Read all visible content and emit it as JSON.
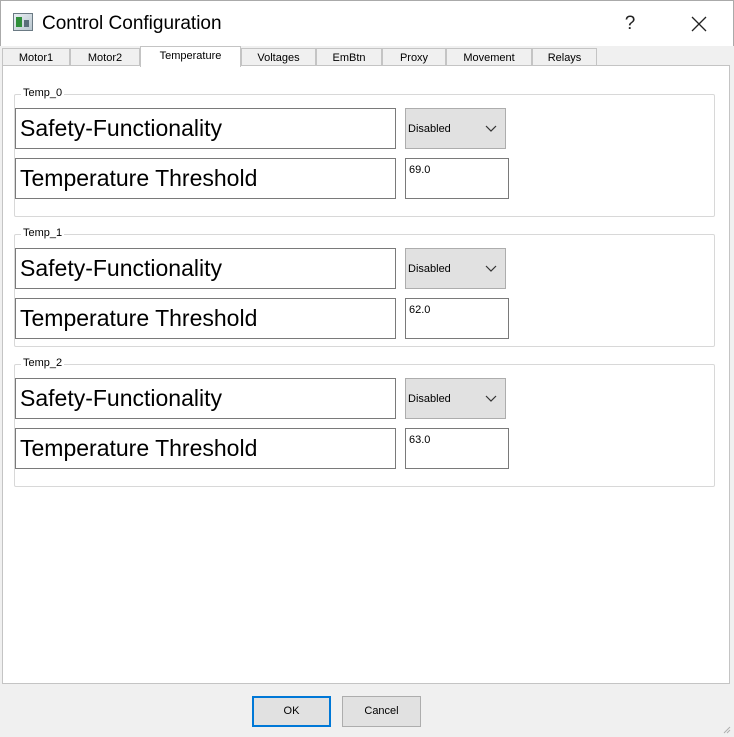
{
  "window": {
    "title": "Control Configuration",
    "help_glyph": "?",
    "icons": {
      "app": "app-config-icon",
      "close": "close-icon"
    }
  },
  "tabs": [
    {
      "label": "Motor1",
      "active": false
    },
    {
      "label": "Motor2",
      "active": false
    },
    {
      "label": "Temperature",
      "active": true
    },
    {
      "label": "Voltages",
      "active": false
    },
    {
      "label": "EmBtn",
      "active": false
    },
    {
      "label": "Proxy",
      "active": false
    },
    {
      "label": "Movement",
      "active": false
    },
    {
      "label": "Relays",
      "active": false
    }
  ],
  "groups": [
    {
      "title": "Temp_0",
      "safety_label": "Safety-Functionality",
      "safety_value": "Disabled",
      "threshold_label": "Temperature Threshold",
      "threshold_value": "69.0"
    },
    {
      "title": "Temp_1",
      "safety_label": "Safety-Functionality",
      "safety_value": "Disabled",
      "threshold_label": "Temperature Threshold",
      "threshold_value": "62.0"
    },
    {
      "title": "Temp_2",
      "safety_label": "Safety-Functionality",
      "safety_value": "Disabled",
      "threshold_label": "Temperature Threshold",
      "threshold_value": "63.0"
    }
  ],
  "buttons": {
    "ok_label": "OK",
    "cancel_label": "Cancel"
  },
  "colors": {
    "default_button_border": "#0078d7",
    "tab_active_bg": "#ffffff",
    "dialog_bg": "#f0f0f0"
  }
}
